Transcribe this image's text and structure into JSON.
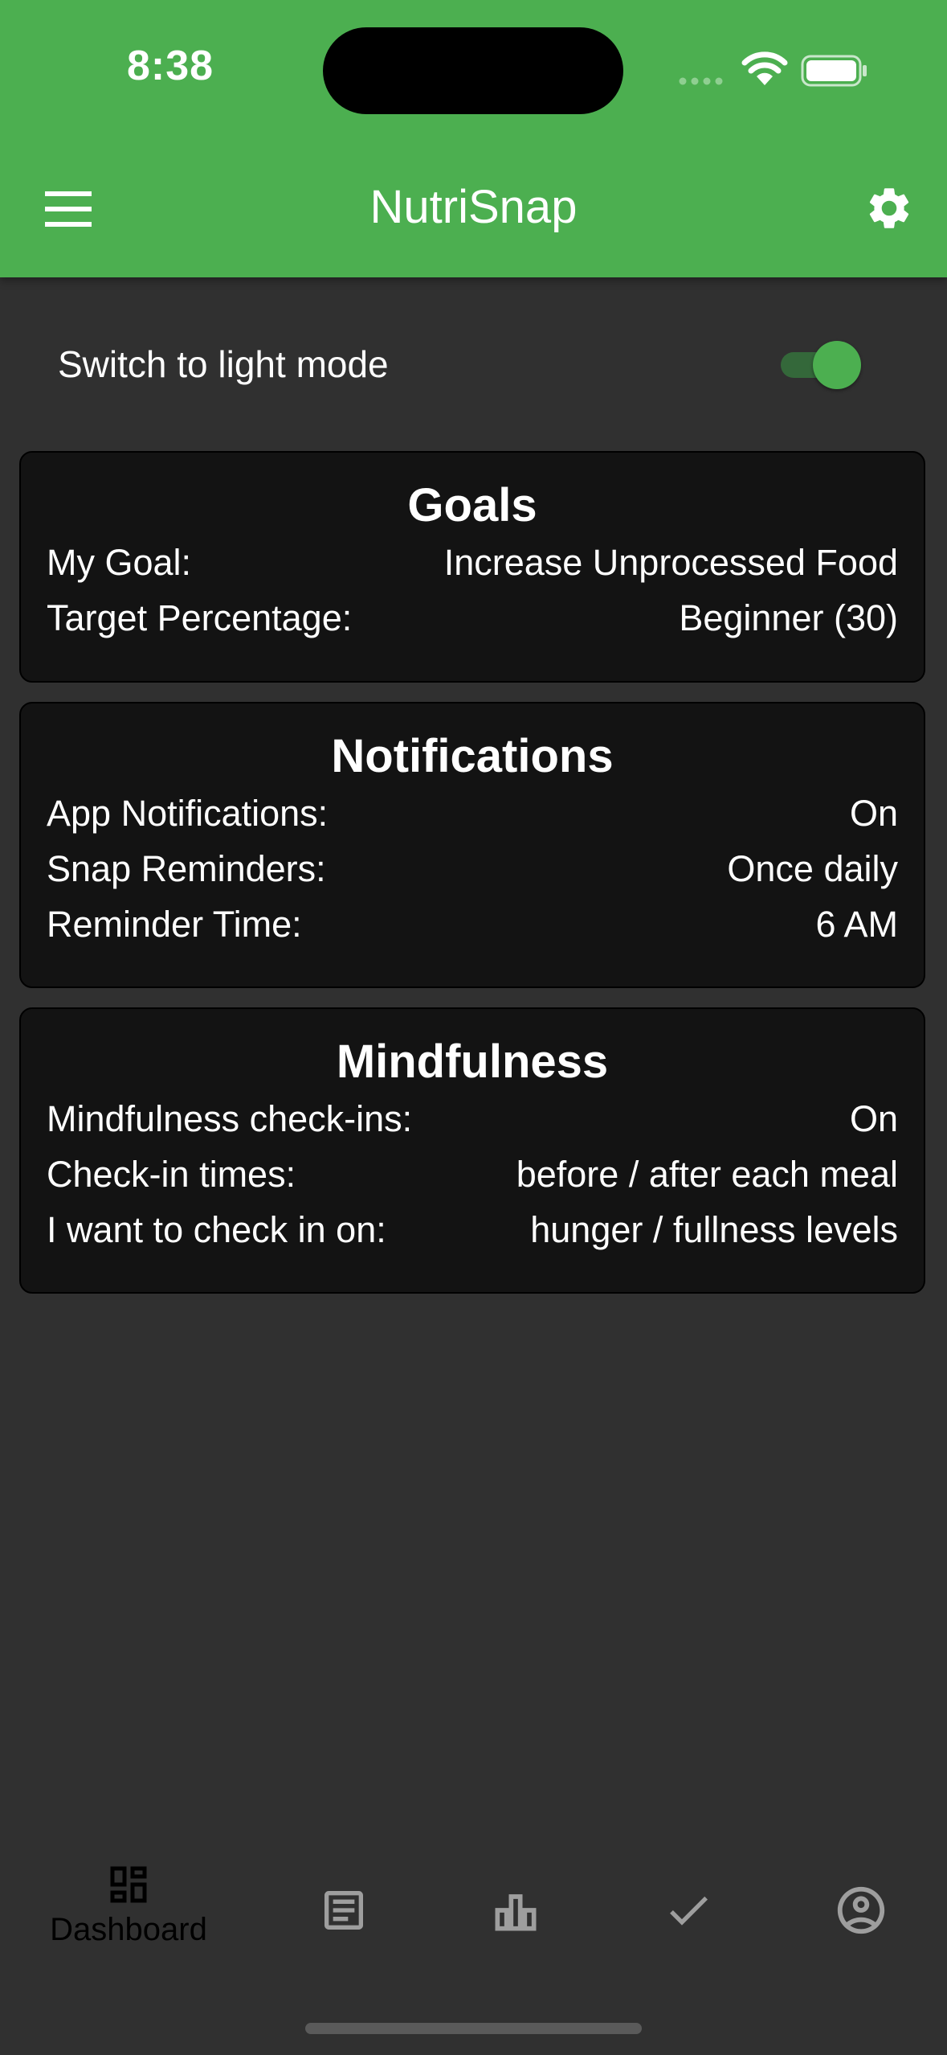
{
  "status_bar": {
    "time": "8:38"
  },
  "app_bar": {
    "title": "NutriSnap"
  },
  "theme_toggle": {
    "label": "Switch to light mode",
    "on": true
  },
  "cards": {
    "goals": {
      "title": "Goals",
      "rows": [
        {
          "label": "My Goal:",
          "value": "Increase Unprocessed Food"
        },
        {
          "label": "Target Percentage:",
          "value": "Beginner (30)"
        }
      ]
    },
    "notifications": {
      "title": "Notifications",
      "rows": [
        {
          "label": "App Notifications:",
          "value": "On"
        },
        {
          "label": "Snap Reminders:",
          "value": "Once daily"
        },
        {
          "label": "Reminder Time:",
          "value": "6 AM"
        }
      ]
    },
    "mindfulness": {
      "title": "Mindfulness",
      "rows": [
        {
          "label": "Mindfulness check-ins:",
          "value": "On"
        },
        {
          "label": "Check-in times:",
          "value": "before / after each meal"
        },
        {
          "label": "I want to check in on:",
          "value": "hunger / fullness levels"
        }
      ]
    }
  },
  "bottom_nav": {
    "items": [
      {
        "icon": "dashboard-icon",
        "label": "Dashboard",
        "active": true
      },
      {
        "icon": "article-icon",
        "label": ""
      },
      {
        "icon": "bar-chart-icon",
        "label": ""
      },
      {
        "icon": "check-icon",
        "label": ""
      },
      {
        "icon": "account-circle-icon",
        "label": ""
      }
    ]
  },
  "colors": {
    "primary": "#4caf50",
    "background": "#303030",
    "card": "#131313"
  }
}
